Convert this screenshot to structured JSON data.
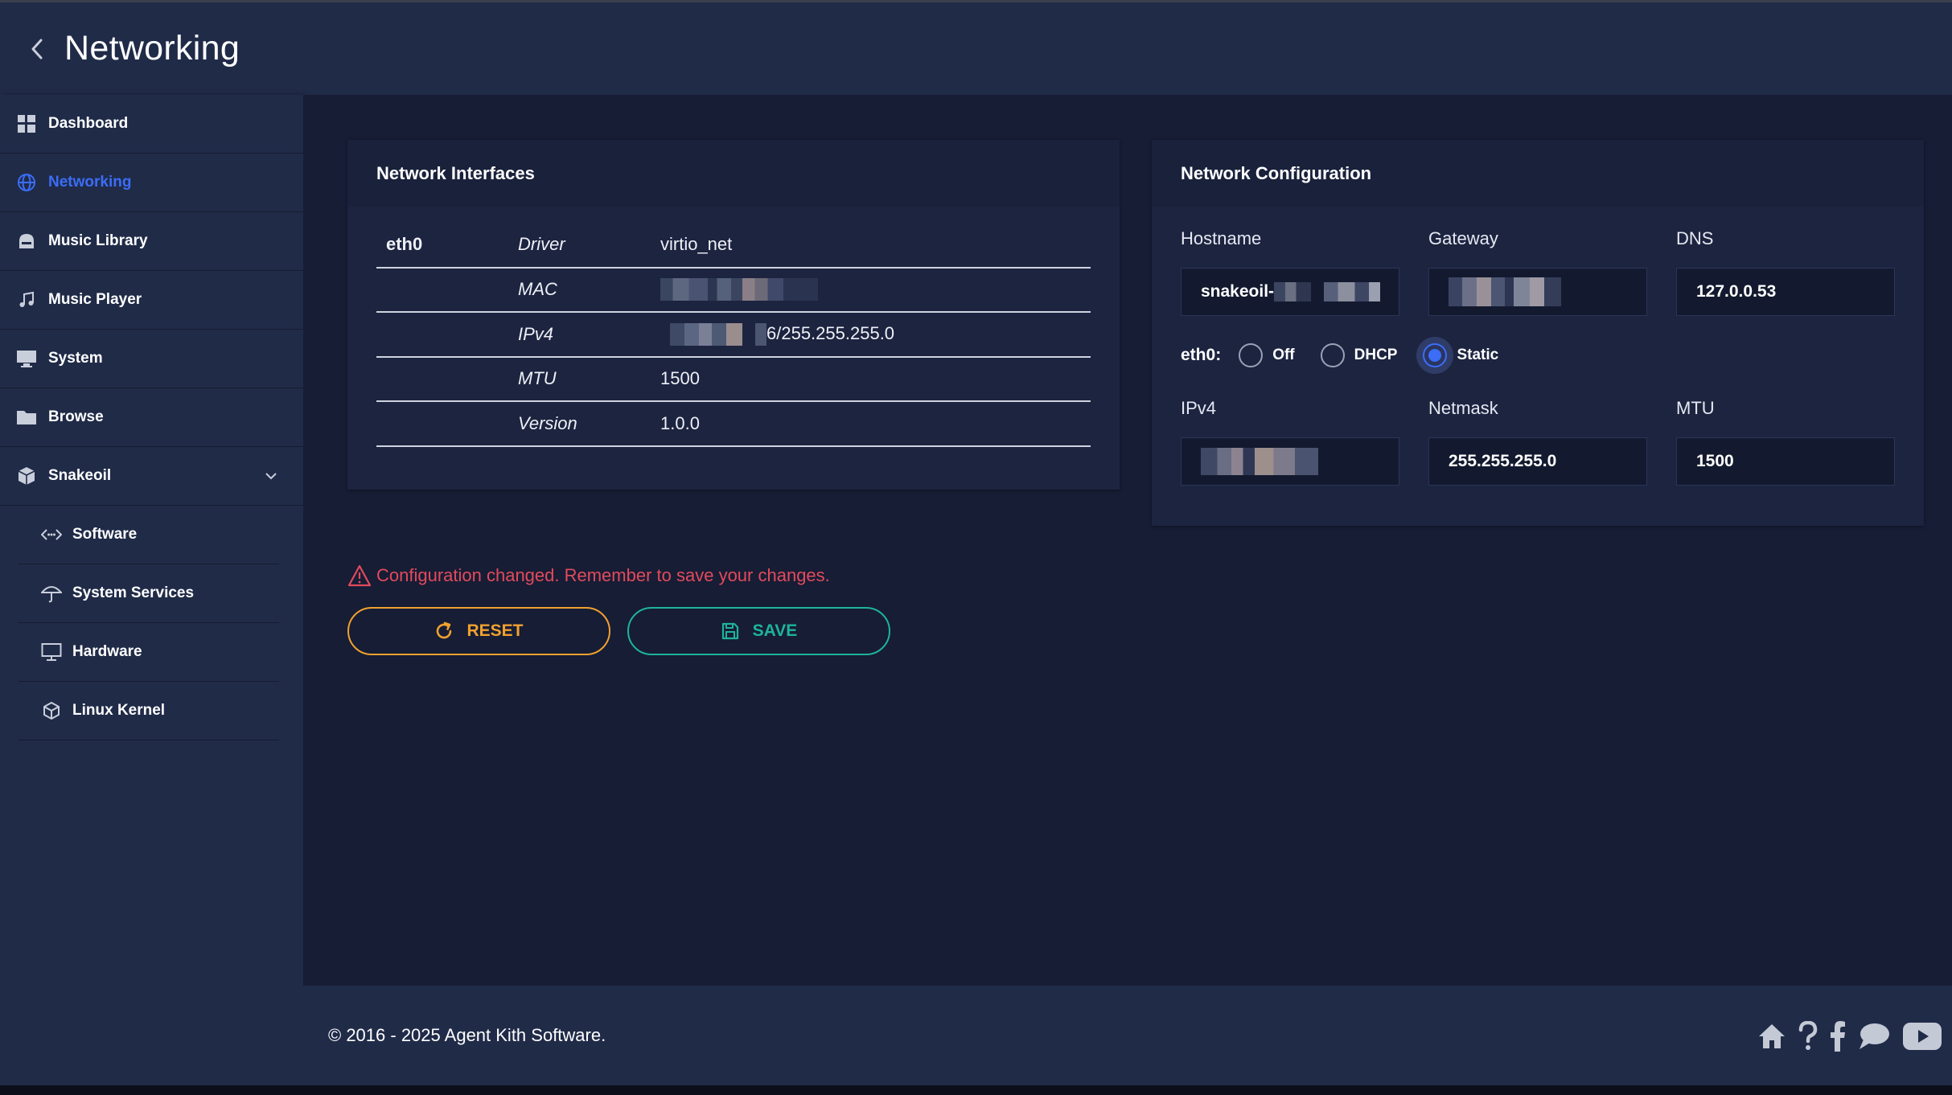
{
  "header": {
    "title": "Networking"
  },
  "sidebar": {
    "items": [
      {
        "label": "Dashboard",
        "icon": "dashboard-grid-icon"
      },
      {
        "label": "Networking",
        "icon": "globe-icon",
        "active": true
      },
      {
        "label": "Music Library",
        "icon": "library-icon"
      },
      {
        "label": "Music Player",
        "icon": "music-note-icon"
      },
      {
        "label": "System",
        "icon": "monitor-icon"
      },
      {
        "label": "Browse",
        "icon": "folder-icon"
      },
      {
        "label": "Snakeoil",
        "icon": "package-icon",
        "expanded": true
      }
    ],
    "subitems": [
      {
        "label": "Software",
        "icon": "code-icon"
      },
      {
        "label": "System Services",
        "icon": "umbrella-icon"
      },
      {
        "label": "Hardware",
        "icon": "monitor-icon"
      },
      {
        "label": "Linux Kernel",
        "icon": "cube-icon"
      }
    ]
  },
  "interfaces": {
    "title": "Network Interfaces",
    "iface_name": "eth0",
    "rows": [
      {
        "key": "Driver",
        "value": "virtio_net"
      },
      {
        "key": "MAC",
        "value": ""
      },
      {
        "key": "IPv4",
        "value": "6/255.255.255.0"
      },
      {
        "key": "MTU",
        "value": "1500"
      },
      {
        "key": "Version",
        "value": "1.0.0"
      }
    ]
  },
  "config": {
    "title": "Network Configuration",
    "hostname_label": "Hostname",
    "hostname_value": "snakeoil-",
    "gateway_label": "Gateway",
    "dns_label": "DNS",
    "dns_value": "127.0.0.53",
    "iface_label": "eth0",
    "iface_colon": ":",
    "mode_options": [
      "Off",
      "DHCP",
      "Static"
    ],
    "mode_selected": "Static",
    "ipv4_label": "IPv4",
    "netmask_label": "Netmask",
    "netmask_value": "255.255.255.0",
    "mtu_label": "MTU",
    "mtu_value": "1500"
  },
  "warning": {
    "text": "Configuration changed. Remember to save your changes."
  },
  "actions": {
    "reset_label": "RESET",
    "save_label": "SAVE"
  },
  "footer": {
    "copyright": "© 2016 - 2025 Agent Kith Software.",
    "icons": [
      "home-icon",
      "help-icon",
      "facebook-icon",
      "chat-icon",
      "youtube-icon"
    ]
  },
  "colors": {
    "accent": "#3b6df6",
    "warning": "#e34a5c",
    "reset": "#f0a12e",
    "save": "#1fb39a",
    "background": "#1c2440"
  }
}
